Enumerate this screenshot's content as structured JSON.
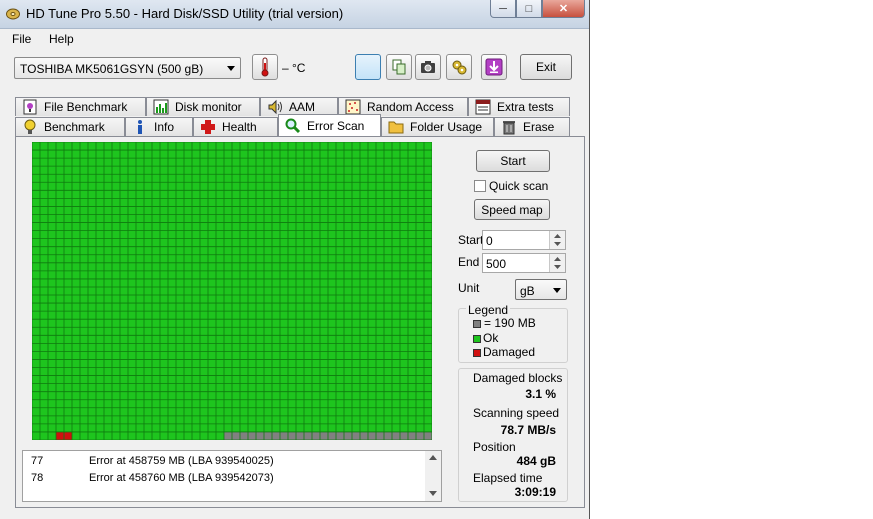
{
  "window": {
    "title": "HD Tune Pro 5.50 - Hard Disk/SSD Utility (trial version)",
    "min_symbol": "─",
    "max_symbol": "□",
    "close_symbol": "✕"
  },
  "menu": {
    "file_label": "File",
    "help_label": "Help"
  },
  "toolbar": {
    "drive_value": "TOSHIBA MK5061GSYN (500 gB)",
    "temperature": "– °C",
    "exit_label": "Exit",
    "icons": [
      "thermometer-icon",
      "blank-icon",
      "copy-icon",
      "camera-icon",
      "settings-icon",
      "save-icon"
    ]
  },
  "tabs_row1": [
    {
      "label": "File Benchmark"
    },
    {
      "label": "Disk monitor"
    },
    {
      "label": "AAM"
    },
    {
      "label": "Random Access"
    },
    {
      "label": "Extra tests"
    }
  ],
  "tabs_row2": [
    {
      "label": "Benchmark"
    },
    {
      "label": "Info"
    },
    {
      "label": "Health"
    },
    {
      "label": "Error Scan"
    },
    {
      "label": "Folder Usage"
    },
    {
      "label": "Erase"
    }
  ],
  "selected_tab": "Error Scan",
  "controls": {
    "start_label": "Start",
    "quick_scan_label": "Quick scan",
    "quick_scan_checked": false,
    "speed_map_label": "Speed map",
    "start_field_label": "Start",
    "start_value": "0",
    "end_field_label": "End",
    "end_value": "500",
    "unit_label": "Unit",
    "unit_value": "gB"
  },
  "legend": {
    "title": "Legend",
    "block_size": "= 190 MB",
    "ok": "Ok",
    "damaged": "Damaged",
    "colors": {
      "unscanned": "#808080",
      "ok": "#1ec51e",
      "damaged": "#d01010"
    }
  },
  "stats": {
    "damaged_blocks_label": "Damaged blocks",
    "damaged_blocks_value": "3.1 %",
    "scanning_speed_label": "Scanning speed",
    "scanning_speed_value": "78.7 MB/s",
    "position_label": "Position",
    "position_value": "484 gB",
    "elapsed_label": "Elapsed time",
    "elapsed_value": "3:09:19"
  },
  "log": [
    {
      "num": "77",
      "msg": "Error at 458759 MB (LBA 939540025)"
    },
    {
      "num": "78",
      "msg": "Error at 458760 MB (LBA 939542073)"
    }
  ],
  "scan_map": {
    "columns": 50,
    "rows": 37,
    "last_row_ok_blocks": 24,
    "damaged_blocks_last_row": [
      3,
      4
    ]
  }
}
